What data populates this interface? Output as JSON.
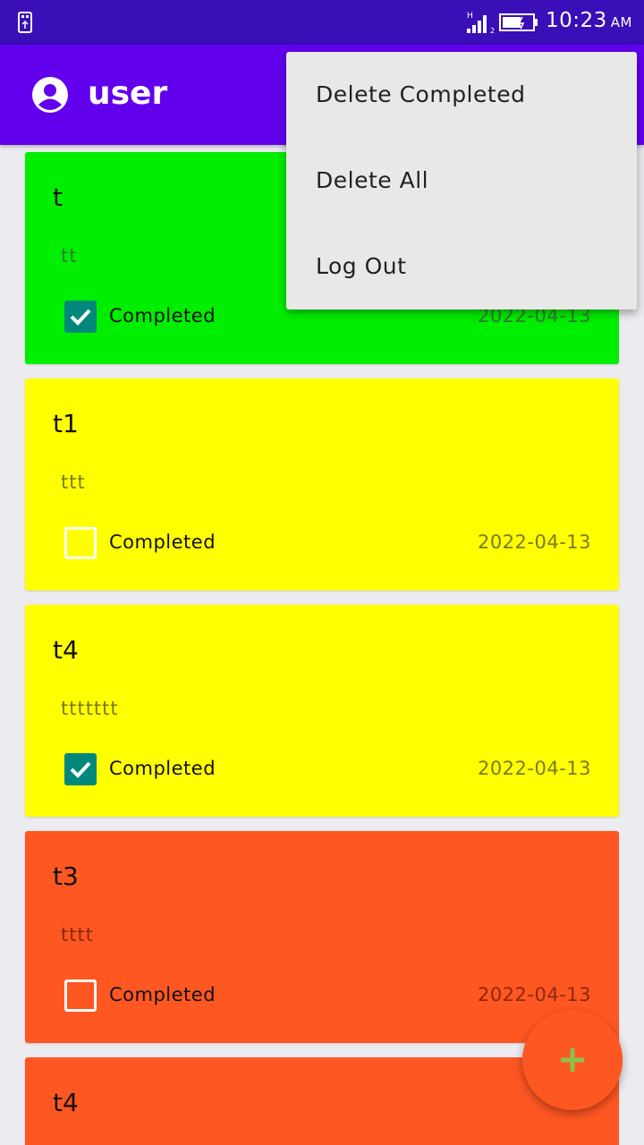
{
  "status_bar": {
    "time": "10:23",
    "ampm": "AM",
    "network_type": "H",
    "sim_slot": "2",
    "icons": [
      "usb-icon",
      "signal-icon",
      "battery-icon"
    ]
  },
  "app_bar": {
    "title": "user",
    "icon": "account-circle-icon",
    "background": "#6200ee"
  },
  "menu": {
    "items": [
      {
        "label": "Delete Completed"
      },
      {
        "label": "Delete All"
      },
      {
        "label": "Log Out"
      }
    ]
  },
  "tasks": [
    {
      "title": "t",
      "description": "tt",
      "completed": true,
      "completed_label": "Completed",
      "date": "2022-04-13",
      "color": "#00ee00"
    },
    {
      "title": "t1",
      "description": "ttt",
      "completed": false,
      "completed_label": "Completed",
      "date": "2022-04-13",
      "color": "#ffff00"
    },
    {
      "title": "t4",
      "description": "ttttttt",
      "completed": true,
      "completed_label": "Completed",
      "date": "2022-04-13",
      "color": "#ffff00"
    },
    {
      "title": "t3",
      "description": "tttt",
      "completed": false,
      "completed_label": "Completed",
      "date": "2022-04-13",
      "color": "#ff5722"
    },
    {
      "title": "t4",
      "description": "",
      "completed": false,
      "completed_label": "",
      "date": "",
      "color": "#ff5722"
    }
  ],
  "fab": {
    "icon": "plus-icon",
    "background": "#ff5722",
    "icon_color": "#8bc34a"
  }
}
